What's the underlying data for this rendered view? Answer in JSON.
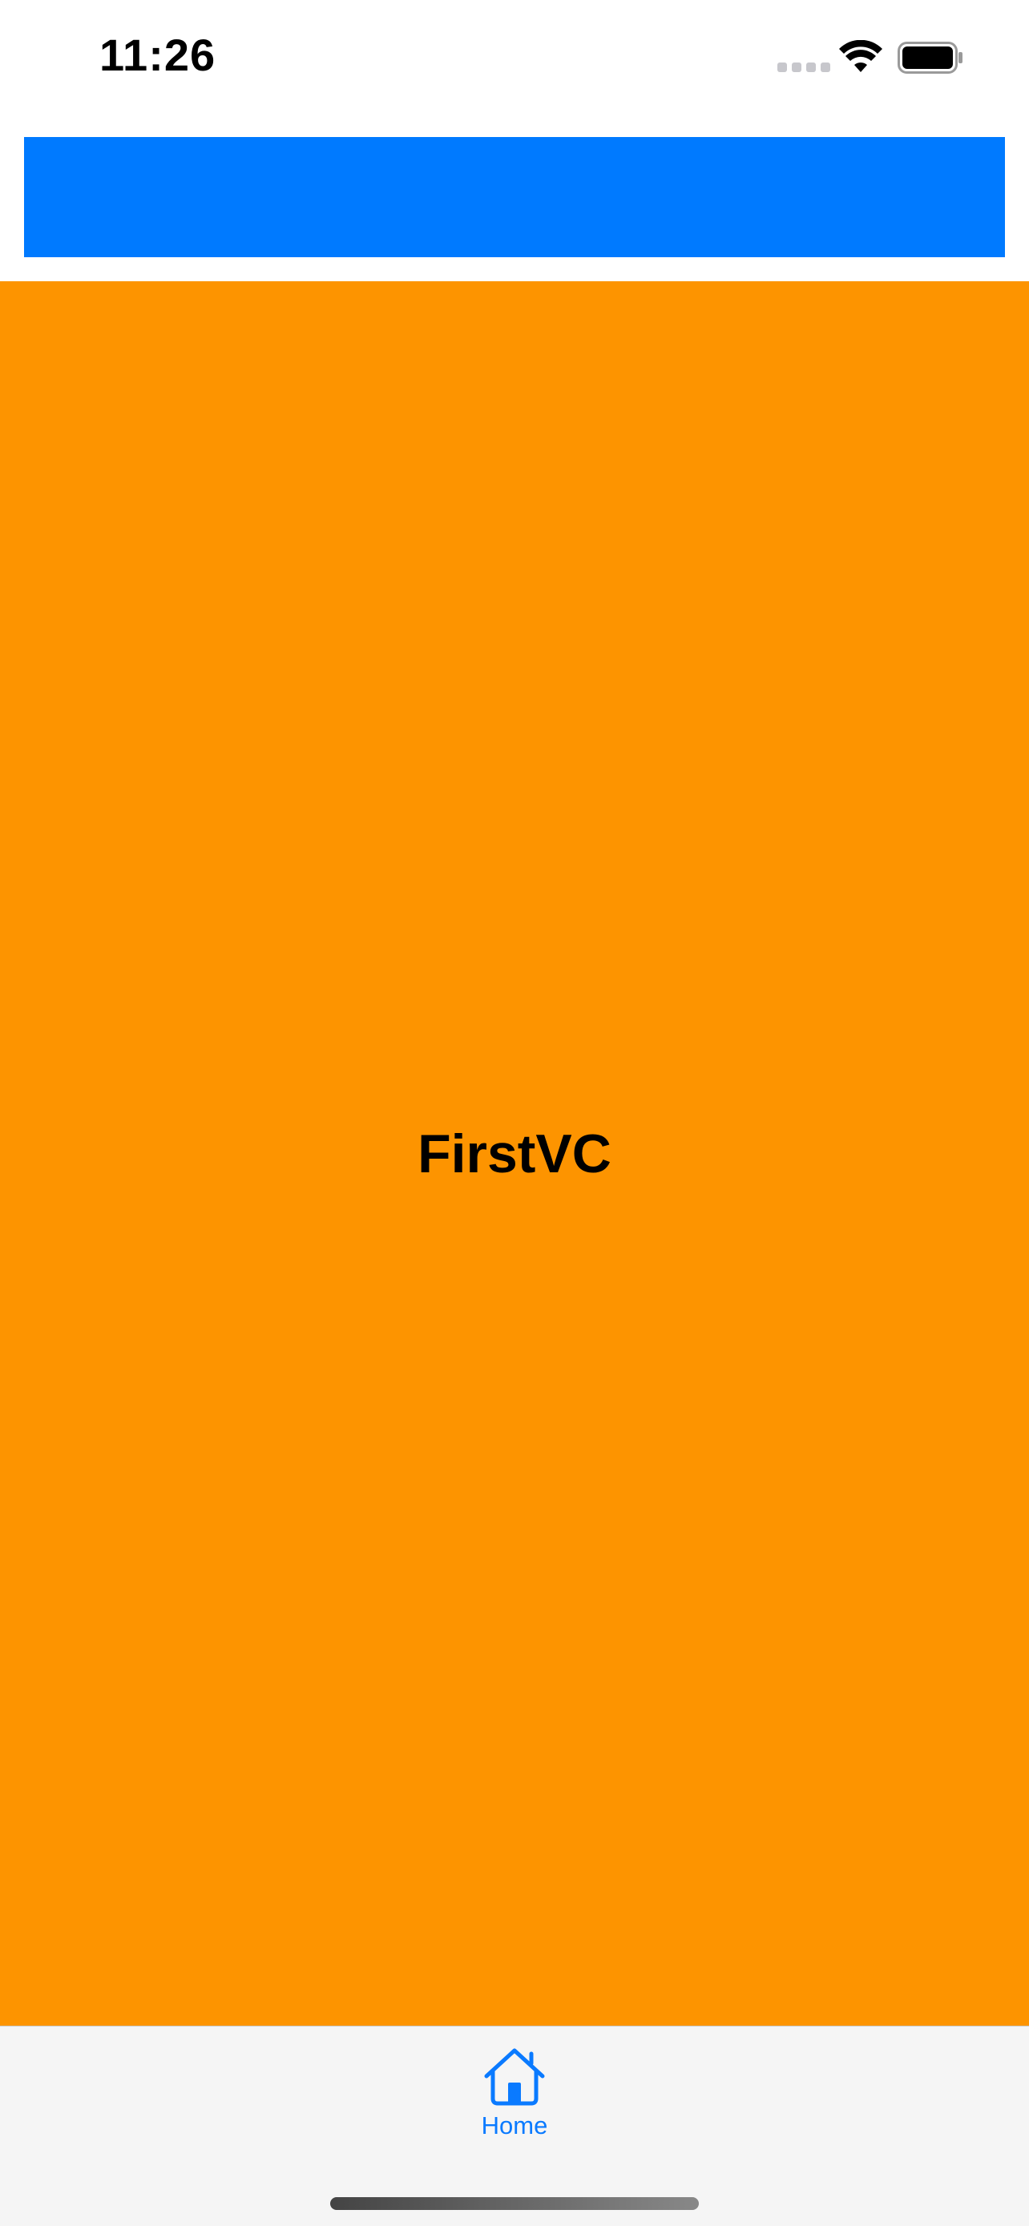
{
  "status_bar": {
    "time": "11:26"
  },
  "colors": {
    "accent_blue": "#007aff",
    "content_orange": "#fd9400",
    "tab_bar_bg": "#f5f5f5",
    "tab_active": "#0a7aff"
  },
  "content": {
    "title": "FirstVC"
  },
  "tab_bar": {
    "items": [
      {
        "label": "Home",
        "icon": "house-icon",
        "selected": true
      }
    ]
  }
}
